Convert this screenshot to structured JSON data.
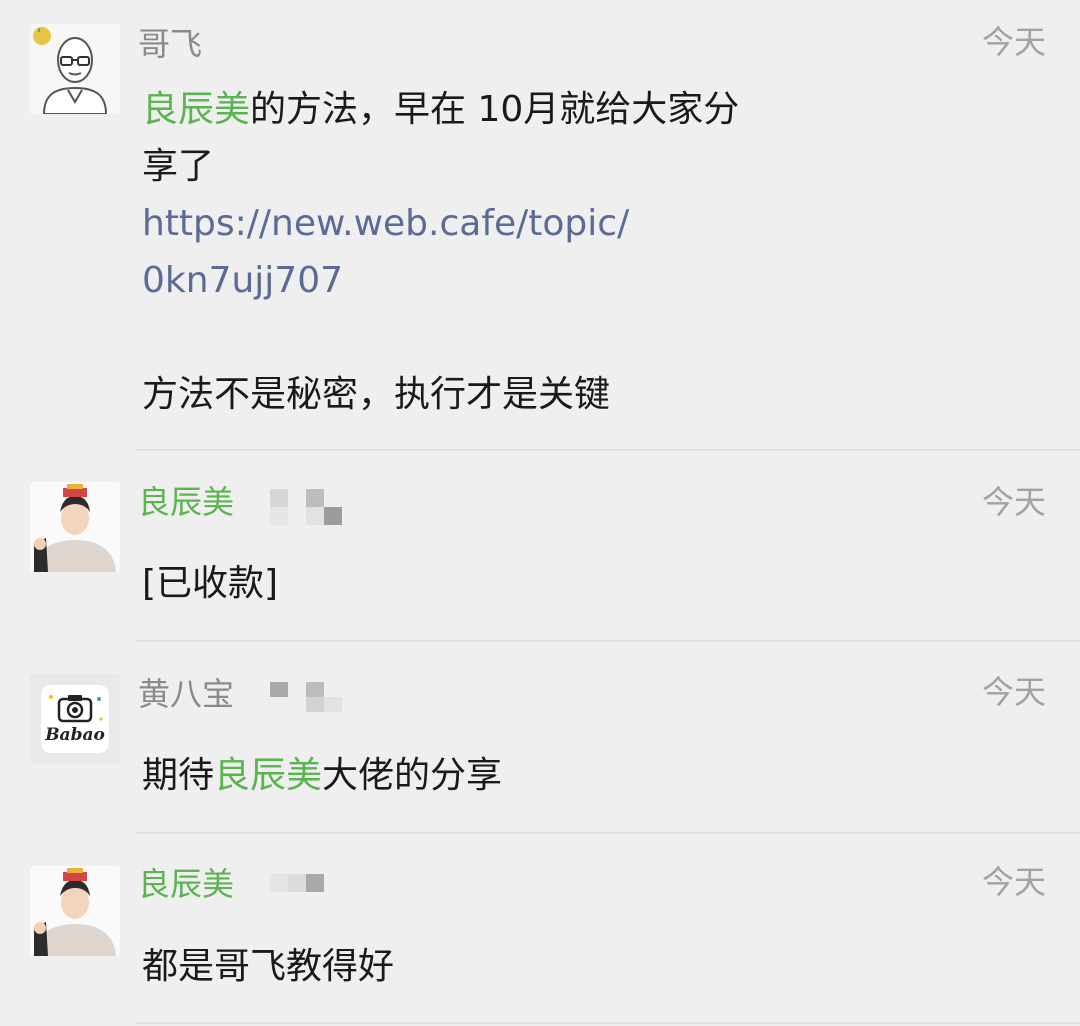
{
  "comments": [
    {
      "nickname": "哥飞",
      "time": "今天",
      "mention": "良辰美",
      "line1_rest": "的方法，早在 10月就给大家分",
      "line2": "享了",
      "link_line1": "https://new.web.cafe/topic/",
      "link_line2": "0kn7ujj707",
      "line3": "方法不是秘密，执行才是关键"
    },
    {
      "nickname": "良辰美",
      "time": "今天",
      "text": "[已收款]"
    },
    {
      "nickname": "黄八宝",
      "time": "今天",
      "text_pre": "期待",
      "mention": "良辰美",
      "text_post": "大佬的分享",
      "avatar_label": "Babao"
    },
    {
      "nickname": "良辰美",
      "time": "今天",
      "text": "都是哥飞教得好"
    }
  ],
  "colors": {
    "background": "#efefef",
    "mention_green": "#5bb450",
    "link_blue": "#5b6b95",
    "nickname_gray": "#8a8a8a",
    "time_gray": "#a2a2a2"
  }
}
